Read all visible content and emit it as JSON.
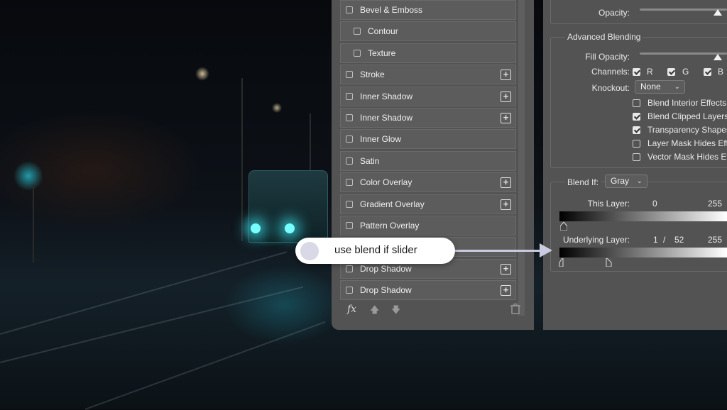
{
  "styles_list": [
    {
      "label": "Bevel & Emboss",
      "indent": false,
      "plus": false
    },
    {
      "label": "Contour",
      "indent": true,
      "plus": false
    },
    {
      "label": "Texture",
      "indent": true,
      "plus": false
    },
    {
      "label": "Stroke",
      "indent": false,
      "plus": true
    },
    {
      "label": "Inner Shadow",
      "indent": false,
      "plus": true
    },
    {
      "label": "Inner Shadow",
      "indent": false,
      "plus": true
    },
    {
      "label": "Inner Glow",
      "indent": false,
      "plus": false
    },
    {
      "label": "Satin",
      "indent": false,
      "plus": false
    },
    {
      "label": "Color Overlay",
      "indent": false,
      "plus": true
    },
    {
      "label": "Gradient Overlay",
      "indent": false,
      "plus": true
    },
    {
      "label": "Pattern Overlay",
      "indent": false,
      "plus": false
    },
    {
      "label": "",
      "indent": false,
      "plus": false
    },
    {
      "label": "Drop Shadow",
      "indent": false,
      "plus": true
    },
    {
      "label": "Drop Shadow",
      "indent": false,
      "plus": true
    }
  ],
  "footer": {
    "fx_label": "fx"
  },
  "blending": {
    "opacity_label": "Opacity:",
    "advanced_title": "Advanced Blending",
    "fill_opacity_label": "Fill Opacity:",
    "channels_label": "Channels:",
    "channel_r": "R",
    "channel_g": "G",
    "channel_b": "B",
    "knockout_label": "Knockout:",
    "knockout_value": "None",
    "options": [
      {
        "label": "Blend Interior Effects",
        "checked": false
      },
      {
        "label": "Blend Clipped Layers",
        "checked": true
      },
      {
        "label": "Transparency Shapes",
        "checked": true
      },
      {
        "label": "Layer Mask Hides Effects",
        "checked": false
      },
      {
        "label": "Vector Mask Hides Effects",
        "checked": false
      }
    ],
    "blend_if_label": "Blend If:",
    "blend_if_value": "Gray",
    "this_layer_label": "This Layer:",
    "this_layer_min": "0",
    "this_layer_max": "255",
    "underlying_label": "Underlying Layer:",
    "underlying_a": "1",
    "underlying_sep": "/",
    "underlying_b": "52",
    "underlying_max": "255"
  },
  "callout": {
    "text": "use blend if slider"
  },
  "colors": {
    "panel": "#535353",
    "callout_arrow": "#c9cbe0"
  }
}
